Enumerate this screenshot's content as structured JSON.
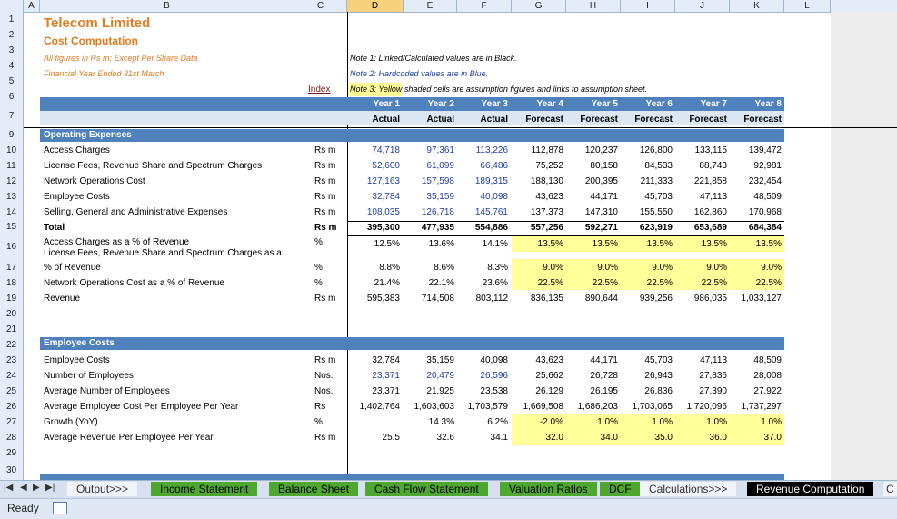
{
  "columns": [
    "A",
    "B",
    "C",
    "D",
    "E",
    "F",
    "G",
    "H",
    "I",
    "J",
    "K",
    "L"
  ],
  "rows": [
    "1",
    "2",
    "3",
    "4",
    "5",
    "6",
    "7",
    "9",
    "10",
    "11",
    "12",
    "13",
    "14",
    "15",
    "16",
    "17",
    "18",
    "19",
    "20",
    "21",
    "22",
    "23",
    "24",
    "25",
    "26",
    "27",
    "28",
    "29",
    "30"
  ],
  "header": {
    "company": "Telecom Limited",
    "title": "Cost Computation",
    "note_figures": "All figures in Rs m; Except Per Share Data",
    "note_year": "Financial Year Ended 31st March",
    "index_link": "Index",
    "note1": "Note 1: Linked/Calculated values are in Black.",
    "note2": "Note 2: Hardcoded values are in Blue.",
    "note3": "Note 3: Yellow shaded cells are assumption figures and links to assumption sheet."
  },
  "years": [
    "Year 1",
    "Year 2",
    "Year 3",
    "Year 4",
    "Year 5",
    "Year 6",
    "Year 7",
    "Year 8"
  ],
  "year_types": [
    "Actual",
    "Actual",
    "Actual",
    "Forecast",
    "Forecast",
    "Forecast",
    "Forecast",
    "Forecast"
  ],
  "sections": {
    "opex": "Operating Expenses",
    "emp": "Employee Costs"
  },
  "opex_rows": [
    {
      "label": "Access Charges",
      "unit": "Rs m",
      "vals": [
        "74,718",
        "97,361",
        "113,226",
        "112,878",
        "120,237",
        "126,800",
        "133,115",
        "139,472"
      ]
    },
    {
      "label": "License Fees, Revenue Share and Spectrum Charges",
      "unit": "Rs m",
      "vals": [
        "52,600",
        "61,099",
        "66,486",
        "75,252",
        "80,158",
        "84,533",
        "88,743",
        "92,981"
      ]
    },
    {
      "label": "Network Operations Cost",
      "unit": "Rs m",
      "vals": [
        "127,163",
        "157,598",
        "189,315",
        "188,130",
        "200,395",
        "211,333",
        "221,858",
        "232,454"
      ]
    },
    {
      "label": "Employee Costs",
      "unit": "Rs m",
      "vals": [
        "32,784",
        "35,159",
        "40,098",
        "43,623",
        "44,171",
        "45,703",
        "47,113",
        "48,509"
      ]
    },
    {
      "label": "Selling, General and Administrative Expenses",
      "unit": "Rs m",
      "vals": [
        "108,035",
        "126,718",
        "145,761",
        "137,373",
        "147,310",
        "155,550",
        "162,860",
        "170,968"
      ]
    }
  ],
  "total_row": {
    "label": "Total",
    "unit": "Rs m",
    "vals": [
      "395,300",
      "477,935",
      "554,886",
      "557,256",
      "592,271",
      "623,919",
      "653,689",
      "684,384"
    ]
  },
  "ratio_rows": [
    {
      "label": "Access Charges as a % of Revenue",
      "unit": "%",
      "vals": [
        "12.5%",
        "13.6%",
        "14.1%",
        "13.5%",
        "13.5%",
        "13.5%",
        "13.5%",
        "13.5%"
      ]
    },
    {
      "label": "License Fees, Revenue Share and Spectrum Charges as a",
      "label2": "% of Revenue",
      "unit": "%",
      "vals": [
        "8.8%",
        "8.6%",
        "8.3%",
        "9.0%",
        "9.0%",
        "9.0%",
        "9.0%",
        "9.0%"
      ]
    },
    {
      "label": "Network Operations Cost as a % of Revenue",
      "unit": "%",
      "vals": [
        "21.4%",
        "22.1%",
        "23.6%",
        "22.5%",
        "22.5%",
        "22.5%",
        "22.5%",
        "22.5%"
      ]
    },
    {
      "label": "Revenue",
      "unit": "Rs m",
      "vals": [
        "595,383",
        "714,508",
        "803,112",
        "836,135",
        "890,644",
        "939,256",
        "986,035",
        "1,033,127"
      ]
    }
  ],
  "emp_rows": [
    {
      "label": "Employee Costs",
      "unit": "Rs m",
      "vals": [
        "32,784",
        "35,159",
        "40,098",
        "43,623",
        "44,171",
        "45,703",
        "47,113",
        "48,509"
      ]
    },
    {
      "label": "Number of Employees",
      "unit": "Nos.",
      "vals": [
        "23,371",
        "20,479",
        "26,596",
        "25,662",
        "26,728",
        "26,943",
        "27,836",
        "28,008"
      ]
    },
    {
      "label": "Average Number of Employees",
      "unit": "Nos.",
      "vals": [
        "23,371",
        "21,925",
        "23,538",
        "26,129",
        "26,195",
        "26,836",
        "27,390",
        "27,922"
      ]
    },
    {
      "label": "Average Employee Cost Per Employee Per Year",
      "unit": "Rs",
      "vals": [
        "1,402,764",
        "1,603,603",
        "1,703,579",
        "1,669,508",
        "1,686,203",
        "1,703,065",
        "1,720,096",
        "1,737,297"
      ]
    },
    {
      "label": "Growth (YoY)",
      "unit": "%",
      "vals": [
        "",
        "14.3%",
        "6.2%",
        "-2.0%",
        "1.0%",
        "1.0%",
        "1.0%",
        "1.0%"
      ]
    },
    {
      "label": "Average Revenue Per Employee Per Year",
      "unit": "Rs m",
      "vals": [
        "25.5",
        "32.6",
        "34.1",
        "32.0",
        "34.0",
        "35.0",
        "36.0",
        "37.0"
      ]
    }
  ],
  "tabs": [
    "Output>>>",
    "Income Statement",
    "Balance Sheet",
    "Cash Flow Statement",
    "Valuation Ratios",
    "DCF",
    "Calculations>>>",
    "Revenue Computation",
    "C"
  ],
  "status": {
    "ready": "Ready"
  }
}
